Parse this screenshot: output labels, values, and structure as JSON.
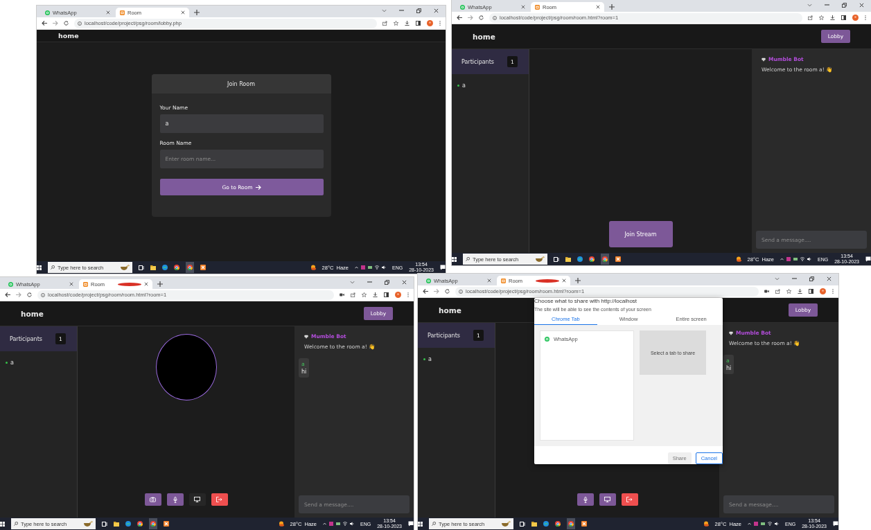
{
  "screens": [
    {
      "tabs": [
        {
          "title": "WhatsApp",
          "kind": "chat",
          "selected": false,
          "recording": false
        },
        {
          "title": "Room",
          "kind": "page",
          "selected": true,
          "recording": false
        }
      ],
      "url": "localhost/code/project/psg/room/lobby.php",
      "page": {
        "kind": "lobby",
        "nav_title": "home",
        "card": {
          "title": "Join Room",
          "fields": [
            {
              "label": "Your Name",
              "value": "a"
            },
            {
              "label": "Room Name",
              "placeholder": "Enter room name..."
            }
          ],
          "button": "Go to Room"
        }
      },
      "taskbar": {
        "search_placeholder": "Type here to search",
        "weather": "28°C  Haze",
        "language": "ENG",
        "time": "13:54",
        "date": "28-10-2023"
      }
    },
    {
      "tabs": [
        {
          "title": "WhatsApp",
          "kind": "chat",
          "selected": false,
          "recording": false
        },
        {
          "title": "Room",
          "kind": "page",
          "selected": true,
          "recording": false
        }
      ],
      "url": "localhost/code/project/psg/room/room.html?room=1",
      "page": {
        "kind": "room",
        "nav_title": "home",
        "lobby_button": "Lobby",
        "participants_title": "Participants",
        "participant_count": "1",
        "members": [
          {
            "name": "a"
          }
        ],
        "join_button": "Join Stream",
        "messages": [
          {
            "kind": "bot",
            "author": "Mumble Bot",
            "text": "Welcome to the room a! 👋"
          }
        ],
        "message_placeholder": "Send a message...."
      },
      "taskbar": {
        "search_placeholder": "Type here to search",
        "weather": "28°C  Haze",
        "language": "ENG",
        "time": "13:54",
        "date": "28-10-2023"
      }
    },
    {
      "tabs": [
        {
          "title": "WhatsApp",
          "kind": "chat",
          "selected": false,
          "recording": false
        },
        {
          "title": "Room",
          "kind": "page",
          "selected": true,
          "recording": true
        }
      ],
      "url": "localhost/code/project/psg/room/room.html?room=1",
      "camera_indicator": true,
      "page": {
        "kind": "room",
        "nav_title": "home",
        "lobby_button": "Lobby",
        "participants_title": "Participants",
        "participant_count": "1",
        "members": [
          {
            "name": "a"
          }
        ],
        "video_on": true,
        "controls": [
          {
            "kind": "camera",
            "on": true
          },
          {
            "kind": "mic",
            "on": true
          },
          {
            "kind": "screen",
            "on": false
          },
          {
            "kind": "leave"
          }
        ],
        "messages": [
          {
            "kind": "bot",
            "author": "Mumble Bot",
            "text": "Welcome to the room a! 👋"
          },
          {
            "kind": "user",
            "author": "a",
            "text": "hi"
          }
        ],
        "message_placeholder": "Send a message...."
      },
      "taskbar": {
        "search_placeholder": "Type here to search",
        "weather": "28°C  Haze",
        "language": "ENG",
        "time": "13:54",
        "date": "28-10-2023"
      }
    },
    {
      "tabs": [
        {
          "title": "WhatsApp",
          "kind": "chat",
          "selected": false,
          "recording": false
        },
        {
          "title": "Room",
          "kind": "page",
          "selected": true,
          "recording": true
        }
      ],
      "url": "localhost/code/project/psg/room/room.html?room=1",
      "camera_indicator": true,
      "page": {
        "kind": "room",
        "nav_title": "home",
        "lobby_button": "Lobby",
        "participants_title": "Participants",
        "participant_count": "1",
        "members": [
          {
            "name": "a"
          }
        ],
        "controls": [
          {
            "kind": "mic",
            "on": true
          },
          {
            "kind": "screen",
            "on": true
          },
          {
            "kind": "leave"
          }
        ],
        "messages": [
          {
            "kind": "bot",
            "author": "Mumble Bot",
            "text": "Welcome to the room a! 👋"
          },
          {
            "kind": "user",
            "author": "a",
            "text": "hi"
          }
        ],
        "message_placeholder": "Send a message....",
        "share_dialog": {
          "title": "Choose what to share with http://localhost",
          "subtitle": "The site will be able to see the contents of your screen",
          "tabs": [
            {
              "label": "Chrome Tab",
              "selected": true
            },
            {
              "label": "Window",
              "selected": false
            },
            {
              "label": "Entire screen",
              "selected": false
            }
          ],
          "items": [
            {
              "title": "WhatsApp",
              "kind": "chat"
            }
          ],
          "preview": "Select a tab to share",
          "buttons": [
            {
              "label": "Share",
              "kind": "secondary"
            },
            {
              "label": "Cancel",
              "kind": "primary"
            }
          ]
        }
      },
      "taskbar": {
        "search_placeholder": "Type here to search",
        "weather": "28°C  Haze",
        "language": "ENG",
        "time": "13:54",
        "date": "28-10-2023"
      }
    }
  ]
}
